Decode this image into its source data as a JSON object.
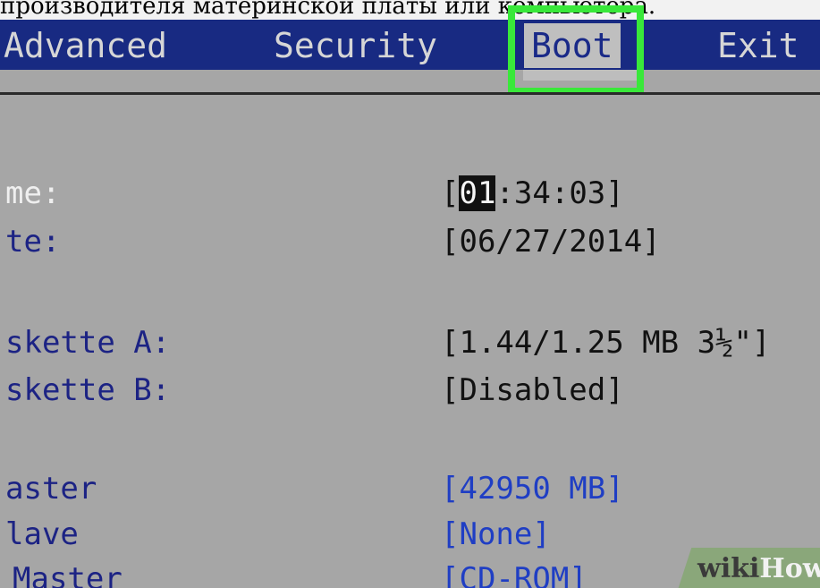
{
  "caption": {
    "text": "производителя материнской платы или компьютера."
  },
  "menu": {
    "items": [
      {
        "label": "Advanced"
      },
      {
        "label": "Security"
      },
      {
        "label": "Boot"
      },
      {
        "label": "Exit"
      }
    ],
    "active": "Boot"
  },
  "settings": [
    {
      "label": "me:",
      "value_open": "[",
      "value_highlight": "01",
      "value_rest": ":34:03]"
    },
    {
      "label": "te:",
      "value": "[06/27/2014]"
    },
    {
      "label": "skette A:",
      "value": "[1.44/1.25 MB  3½\"]"
    },
    {
      "label": "skette B:",
      "value": "[Disabled]"
    },
    {
      "label": "aster",
      "value": "[42950 MB]"
    },
    {
      "label": "lave",
      "value": "[None]"
    },
    {
      "label": "Master",
      "value": "[CD-ROM]"
    }
  ],
  "watermark": {
    "wiki": "wiki",
    "how": "How"
  },
  "colors": {
    "menu_bar": "#182a82",
    "background": "#a6a6a6",
    "highlight": "#39e83a",
    "label_blue": "#1c2384",
    "value_blue": "#1f3ec4"
  }
}
